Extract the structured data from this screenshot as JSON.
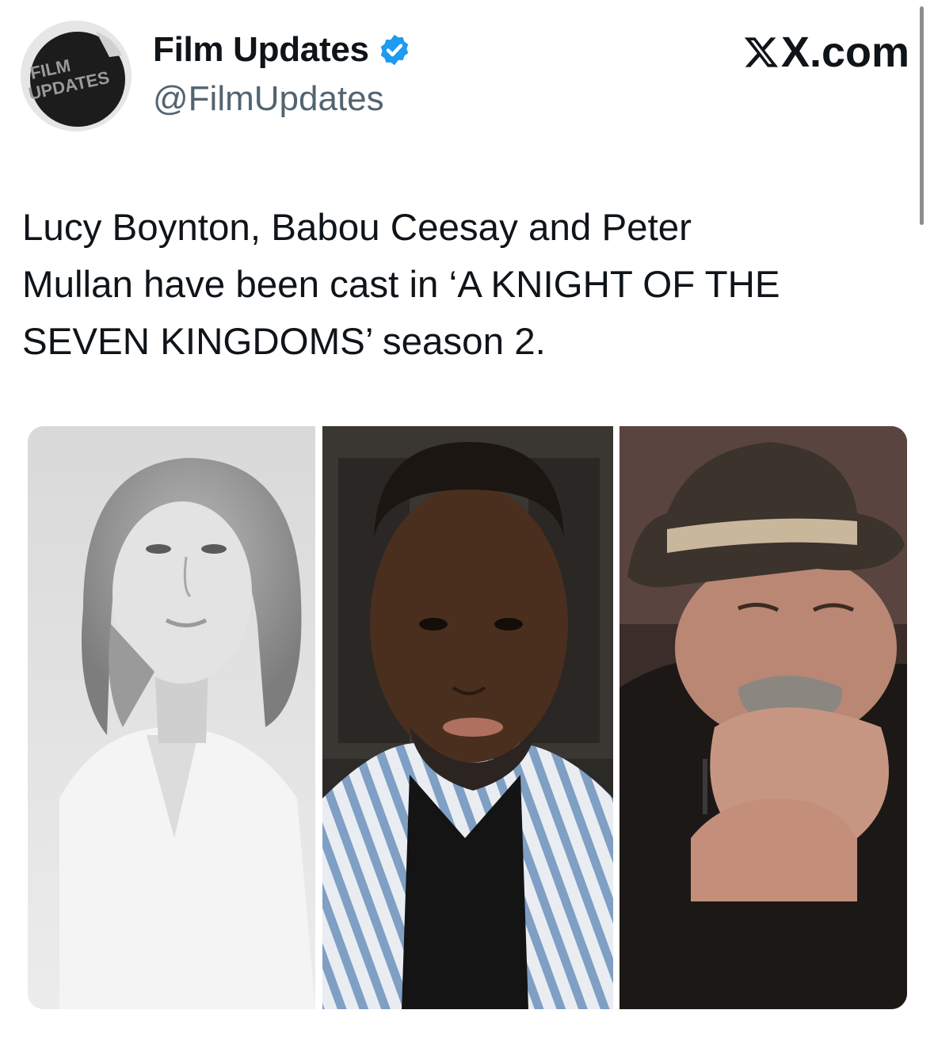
{
  "account": {
    "display_name": "Film Updates",
    "handle": "@FilmUpdates",
    "verified": true,
    "avatar_logo_text": "FILM UPDATES"
  },
  "site_label": "X.com",
  "tweet": {
    "text": "Lucy Boynton, Babou Ceesay and Peter\nMullan have been cast in ‘A KNIGHT OF THE\nSEVEN KINGDOMS’ season 2."
  },
  "media": [
    {
      "subject": "Lucy Boynton portrait (black and white)"
    },
    {
      "subject": "Babou Ceesay portrait"
    },
    {
      "subject": "Peter Mullan portrait"
    }
  ],
  "colors": {
    "text": "#0f1419",
    "secondary_text": "#536471",
    "verified_blue": "#1d9bf0"
  },
  "icons": [
    "verified-badge-icon",
    "x-logo-icon"
  ]
}
